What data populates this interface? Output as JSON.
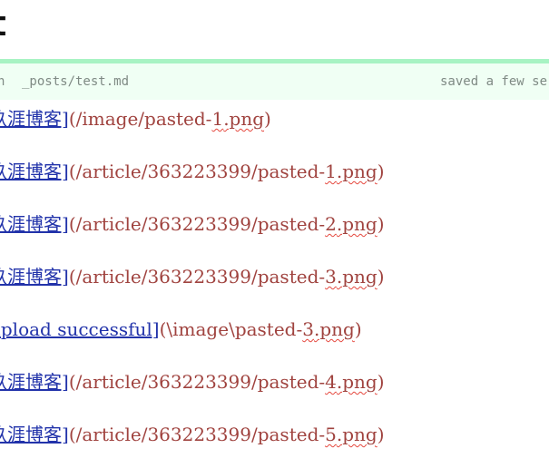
{
  "header": {
    "title": "t"
  },
  "status_bar": {
    "mode": "n",
    "file_path": "_posts/test.md",
    "saved_text": "saved a few se"
  },
  "lines": [
    {
      "link_text": "玖涯博客]",
      "url_prefix": "(/image/pasted-",
      "url_number": "1",
      "url_suffix": ".png",
      "close": ")"
    },
    {
      "link_text": "玖涯博客]",
      "url_prefix": "(/article/363223399/pasted-",
      "url_number": "1",
      "url_suffix": ".png",
      "close": ")"
    },
    {
      "link_text": "玖涯博客]",
      "url_prefix": "(/article/363223399/pasted-",
      "url_number": "2",
      "url_suffix": ".png",
      "close": ")"
    },
    {
      "link_text": "玖涯博客]",
      "url_prefix": "(/article/363223399/pasted-",
      "url_number": "3",
      "url_suffix": ".png",
      "close": ")"
    },
    {
      "link_text": "upload successful]",
      "url_prefix": "(\\image\\pasted-",
      "url_number": "3",
      "url_suffix": ".png",
      "close": ")"
    },
    {
      "link_text": "玖涯博客]",
      "url_prefix": "(/article/363223399/pasted-",
      "url_number": "4",
      "url_suffix": ".png",
      "close": ")"
    },
    {
      "link_text": "玖涯博客]",
      "url_prefix": "(/article/363223399/pasted-",
      "url_number": "5",
      "url_suffix": ".png",
      "close": ")"
    }
  ]
}
